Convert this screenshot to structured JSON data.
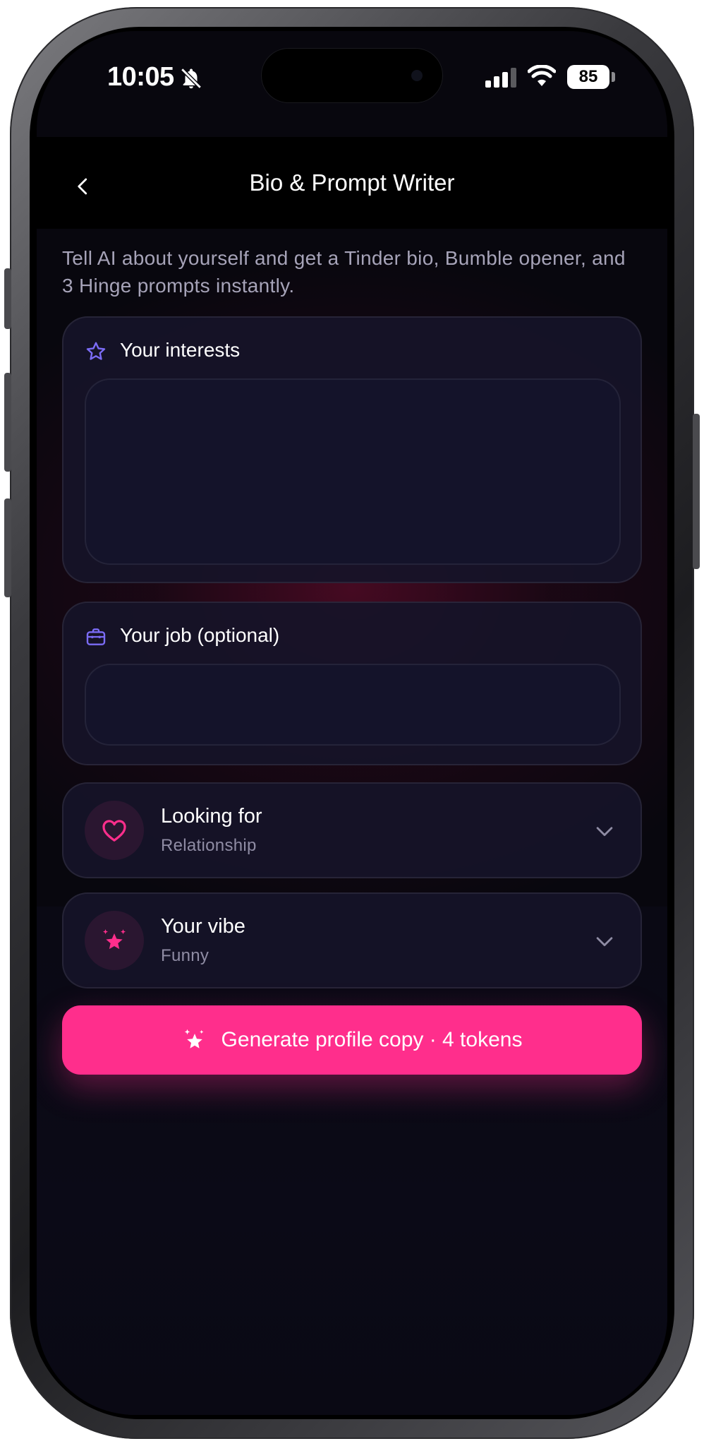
{
  "status_bar": {
    "time": "10:05",
    "battery_level": "85",
    "icons": [
      "bell-slash-icon",
      "signal-icon",
      "wifi-icon",
      "battery-icon"
    ]
  },
  "nav": {
    "title": "Bio & Prompt Writer",
    "back_icon": "chevron-left-icon"
  },
  "intro_text": "Tell AI about yourself and get a Tinder bio, Bumble opener, and 3 Hinge prompts instantly.",
  "interests_card": {
    "label": "Your interests",
    "icon": "star-outline-icon",
    "value": "",
    "placeholder": ""
  },
  "job_card": {
    "label": "Your job (optional)",
    "icon": "briefcase-icon",
    "value": "",
    "placeholder": ""
  },
  "looking_for": {
    "title": "Looking for",
    "value": "Relationship",
    "icon": "heart-icon"
  },
  "vibe": {
    "title": "Your vibe",
    "value": "Funny",
    "icon": "sparkle-star-icon"
  },
  "generate_button": {
    "label": "Generate profile copy · 4 tokens",
    "icon": "sparkles-icon"
  },
  "colors": {
    "accent": "#ff2e8c",
    "background": "#08070e",
    "card": "#16142a",
    "icon_purple": "#7b6cf6",
    "text_secondary": "#a6a3b8"
  }
}
